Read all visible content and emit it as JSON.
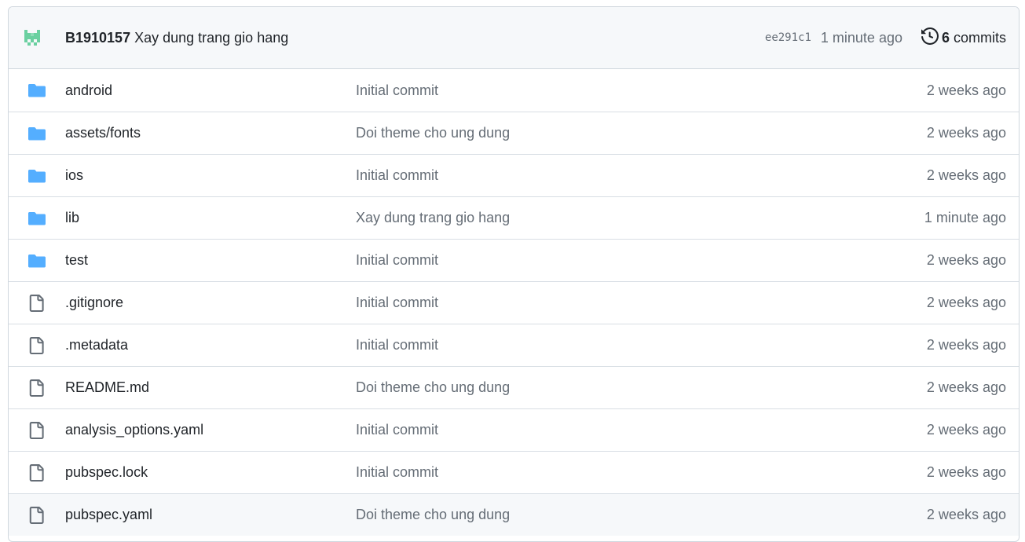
{
  "latest_commit": {
    "author": "B1910157",
    "message": "Xay dung trang gio hang",
    "sha": "ee291c1",
    "time": "1 minute ago",
    "commit_count": "6",
    "commit_word": "commits",
    "icons": {
      "avatar": "identicon-avatar",
      "history": "history-icon"
    }
  },
  "colors": {
    "folder": "#54aeff",
    "file_icon": "#656d76",
    "muted_text": "#656d76",
    "border": "#d0d7de",
    "header_bg": "#f6f8fa",
    "avatar": "#6ad0a0"
  },
  "files": [
    {
      "type": "folder",
      "icon": "folder-icon",
      "name": "android",
      "message": "Initial commit",
      "age": "2 weeks ago"
    },
    {
      "type": "folder",
      "icon": "folder-icon",
      "name": "assets/fonts",
      "message": "Doi theme cho ung dung",
      "age": "2 weeks ago"
    },
    {
      "type": "folder",
      "icon": "folder-icon",
      "name": "ios",
      "message": "Initial commit",
      "age": "2 weeks ago"
    },
    {
      "type": "folder",
      "icon": "folder-icon",
      "name": "lib",
      "message": "Xay dung trang gio hang",
      "age": "1 minute ago"
    },
    {
      "type": "folder",
      "icon": "folder-icon",
      "name": "test",
      "message": "Initial commit",
      "age": "2 weeks ago"
    },
    {
      "type": "file",
      "icon": "file-icon",
      "name": ".gitignore",
      "message": "Initial commit",
      "age": "2 weeks ago"
    },
    {
      "type": "file",
      "icon": "file-icon",
      "name": ".metadata",
      "message": "Initial commit",
      "age": "2 weeks ago"
    },
    {
      "type": "file",
      "icon": "file-icon",
      "name": "README.md",
      "message": "Doi theme cho ung dung",
      "age": "2 weeks ago"
    },
    {
      "type": "file",
      "icon": "file-icon",
      "name": "analysis_options.yaml",
      "message": "Initial commit",
      "age": "2 weeks ago"
    },
    {
      "type": "file",
      "icon": "file-icon",
      "name": "pubspec.lock",
      "message": "Initial commit",
      "age": "2 weeks ago"
    },
    {
      "type": "file",
      "icon": "file-icon",
      "name": "pubspec.yaml",
      "message": "Doi theme cho ung dung",
      "age": "2 weeks ago",
      "highlighted": true
    }
  ]
}
